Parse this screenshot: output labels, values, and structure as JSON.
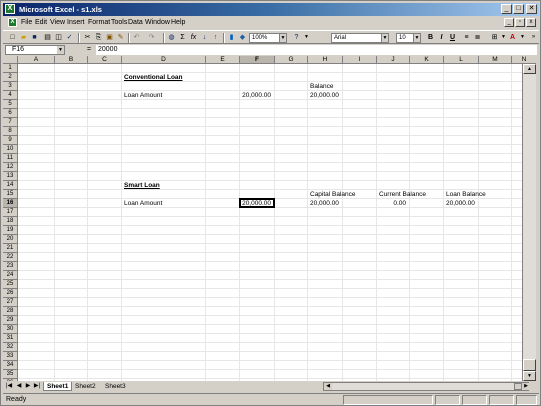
{
  "window": {
    "title": "Microsoft Excel - s1.xls",
    "minimize": "_",
    "maximize": "□",
    "close": "✕"
  },
  "menu": [
    "File",
    "Edit",
    "View",
    "Insert",
    "Format",
    "Tools",
    "Data",
    "Window",
    "Help"
  ],
  "toolbar": {
    "zoom": "100%",
    "font_name": "Arial",
    "font_size": "10",
    "bold": "B",
    "italic": "I",
    "underline": "U",
    "sigma": "Σ",
    "fx": "fx"
  },
  "formula_bar": {
    "name_box": "F16",
    "equals": "=",
    "value": "20000"
  },
  "columns": [
    "A",
    "B",
    "C",
    "D",
    "E",
    "F",
    "G",
    "H",
    "I",
    "J",
    "K",
    "L",
    "M",
    "N"
  ],
  "selected_column": "F",
  "selected_row": 16,
  "rows": [
    "1",
    "2",
    "3",
    "4",
    "5",
    "6",
    "7",
    "8",
    "9",
    "10",
    "11",
    "12",
    "13",
    "14",
    "15",
    "16",
    "17",
    "18",
    "19",
    "20",
    "21",
    "22",
    "23",
    "24",
    "25",
    "26",
    "27",
    "28",
    "29",
    "30",
    "31",
    "32",
    "33",
    "34",
    "35",
    "36"
  ],
  "cells": {
    "D2": "Conventional Loan",
    "H3": "Balance",
    "D4": "Loan Amount",
    "F4": "20,000.00",
    "H4": "20,000.00",
    "D14": "Smart Loan",
    "H15": "Capital Balance",
    "J15": "Current Balance",
    "L15": "Loan Balance",
    "D16": "Loan Amount",
    "F16": "20,000.00",
    "H16": "20,000.00",
    "J16": "0.00",
    "L16": "20,000.00"
  },
  "sheets": [
    "Sheet1",
    "Sheet2",
    "Sheet3"
  ],
  "active_sheet": "Sheet1",
  "status": "Ready"
}
